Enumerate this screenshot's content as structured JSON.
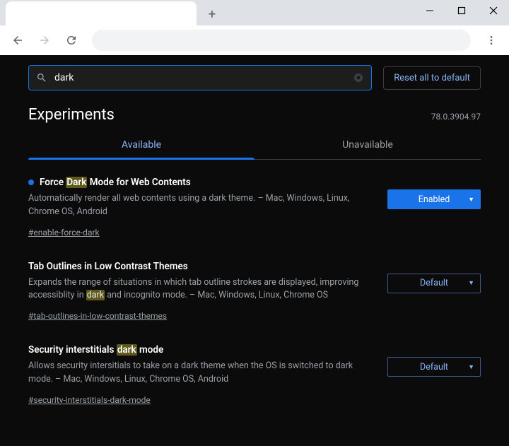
{
  "window": {
    "new_tab_tooltip": "+"
  },
  "toolbar": {},
  "search": {
    "value": "dark"
  },
  "reset_button": "Reset all to default",
  "page_heading": "Experiments",
  "version": "78.0.3904.97",
  "tabs": {
    "available": "Available",
    "unavailable": "Unavailable"
  },
  "flags": [
    {
      "title_pre": "Force ",
      "title_hl": "Dark",
      "title_post": " Mode for Web Contents",
      "desc_pre": "Automatically render all web contents using a dark theme. – Mac, Windows, Linux, Chrome OS, Android",
      "desc_hl": "",
      "desc_post": "",
      "anchor": "#enable-force-dark",
      "select": "Enabled",
      "select_style": "enabled",
      "modified": true
    },
    {
      "title_pre": "Tab Outlines in Low Contrast Themes",
      "title_hl": "",
      "title_post": "",
      "desc_pre": "Expands the range of situations in which tab outline strokes are displayed, improving accessiblity in ",
      "desc_hl": "dark",
      "desc_post": " and incognito mode. – Mac, Windows, Linux, Chrome OS",
      "anchor": "#tab-outlines-in-low-contrast-themes",
      "select": "Default",
      "select_style": "default",
      "modified": false
    },
    {
      "title_pre": "Security interstitials ",
      "title_hl": "dark",
      "title_post": " mode",
      "desc_pre": "Allows security intersitials to take on a dark theme when the OS is switched to dark mode. – Mac, Windows, Linux, Chrome OS, Android",
      "desc_hl": "",
      "desc_post": "",
      "anchor": "#security-interstitials-dark-mode",
      "select": "Default",
      "select_style": "default",
      "modified": false
    }
  ]
}
